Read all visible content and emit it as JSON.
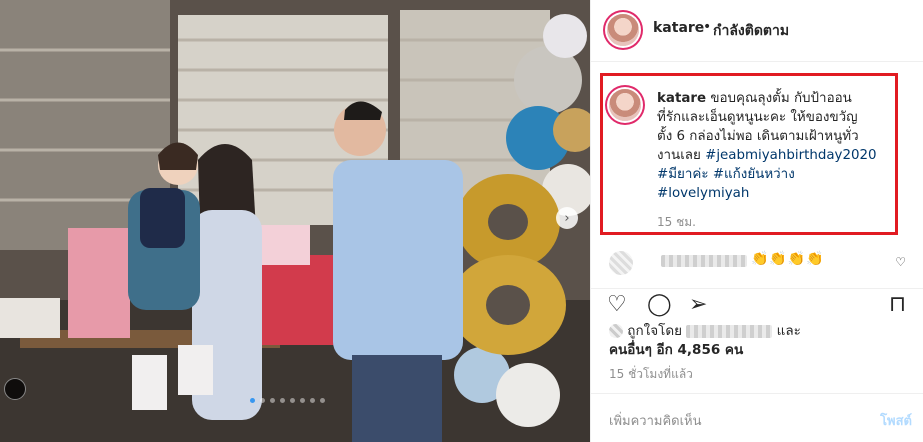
{
  "header": {
    "username": "katare",
    "separator": "•",
    "follow_status": "กำลังติดตาม"
  },
  "caption": {
    "username": "katare",
    "line1": "ขอบคุณลุงตั้ม กับป้าออน",
    "line2": "ที่รักและเอ็นดูหนูนะคะ ให้ของขวัญ",
    "line3": "ตั้ง 6 กล่องไม่พอ เดินตามเฝ้าหนูทั่ว",
    "line4_text": "งานเลย ",
    "hashtag1": "#jeabmiyahbirthday2020",
    "hashtag2": "#มียาค่ะ",
    "hashtag3": "#แก้งยันหว่าง",
    "hashtag4": "#lovelymiyah",
    "time": "15 ชม."
  },
  "comment": {
    "emoji": "👏👏👏👏"
  },
  "likes": {
    "liked_by": "ถูกใจโดย",
    "and": "และ",
    "others": "คนอื่นๆ อีก 4,856 คน"
  },
  "time_ago": "15 ชั่วโมงที่แล้ว",
  "add_comment": {
    "placeholder": "เพิ่มความคิดเห็น",
    "post_label": "โพสต์"
  },
  "icons": {
    "like": "heart-icon",
    "comment": "comment-icon",
    "share": "share-icon",
    "save": "bookmark-icon",
    "next": "chevron-right-icon"
  },
  "carousel": {
    "total": 8,
    "active": 1
  },
  "colors": {
    "highlight_border": "#e11b22",
    "hashtag": "#00376b",
    "post_disabled": "#b3dbff",
    "active_dot": "#3897f0"
  }
}
